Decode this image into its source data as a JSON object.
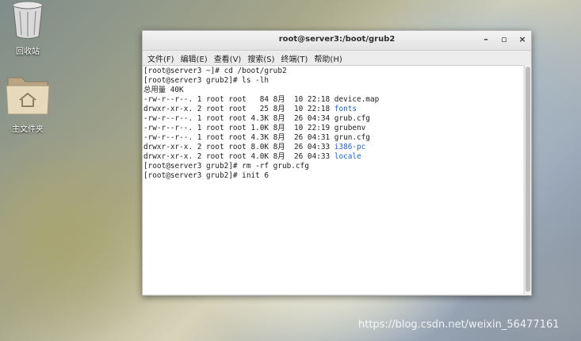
{
  "desktop": {
    "trash_label": "回收站",
    "home_label": "主文件夹"
  },
  "window": {
    "title": "root@server3:/boot/grub2",
    "minimize": "–",
    "maximize": "▫",
    "close": "×"
  },
  "menu": [
    "文件(F)",
    "编辑(E)",
    "查看(V)",
    "搜索(S)",
    "终端(T)",
    "帮助(H)"
  ],
  "terminal": {
    "lines": [
      "[root@server3 ~]# cd /boot/grub2",
      "[root@server3 grub2]# ls -lh",
      "总用量 40K",
      "-rw-r--r--. 1 root root   84 8月  10 22:18 ",
      "drwxr-xr-x. 2 root root   25 8月  10 22:18 ",
      "-rw-r--r--. 1 root root 4.3K 8月  26 04:34 ",
      "-rw-r--r--. 1 root root 1.0K 8月  10 22:19 ",
      "-rw-r--r--. 1 root root 4.3K 8月  26 04:31 ",
      "drwxr-xr-x. 2 root root 8.0K 8月  26 04:33 ",
      "drwxr-xr-x. 2 root root 4.0K 8月  26 04:33 ",
      "[root@server3 grub2]# rm -rf grub.cfg",
      "[root@server3 grub2]# init 6"
    ],
    "files": [
      "device.map",
      "fonts",
      "grub.cfg",
      "grubenv",
      "grun.cfg",
      "i386-pc",
      "locale"
    ]
  },
  "watermark": "https://blog.csdn.net/weixin_56477161"
}
